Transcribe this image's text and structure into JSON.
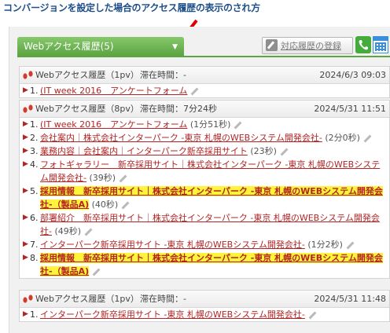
{
  "caption": "コンバージョンを設定した場合のアクセス履歴の表示のされ方",
  "toolbar": {
    "tab_label": "Webアクセス履歴(5)",
    "tab_arrow": "▼",
    "register_label": "対応履歴の登録"
  },
  "visits": [
    {
      "label": "Webアクセス履歴（1pv）",
      "stay": "滞在時間：-",
      "date": "2024/6/3 09:03",
      "pages": [
        {
          "num": "1.",
          "title": "(IT week 2016　アンケートフォーム",
          "suffix": ""
        }
      ]
    },
    {
      "label": "Webアクセス履歴（8pv）",
      "stay": "滞在時間：7分24秒",
      "date": "2024/5/31 11:51",
      "pages": [
        {
          "num": "1.",
          "title": "(IT week 2016　アンケートフォーム",
          "suffix": "(1分51秒)"
        },
        {
          "num": "2.",
          "title": "会社案内｜株式会社インターパーク -東京 札幌のWEBシステム開発会社-",
          "suffix": "(2分0秒)"
        },
        {
          "num": "3.",
          "title": "業務内容｜会社案内｜インターパーク新卒採用サイト",
          "suffix": "(23秒)"
        },
        {
          "num": "4.",
          "title": "フォトギャラリー　新卒採用サイト｜株式会社インターパーク -東京 札幌のWEBシステム開発会社-",
          "suffix": "(39秒)"
        },
        {
          "num": "5.",
          "title": "採用情報　新卒採用サイト｜株式会社インターパーク -東京 札幌のWEBシステム開発会社-（製品A)",
          "suffix": "(40秒)",
          "highlight": true
        },
        {
          "num": "6.",
          "title": "部署紹介　新卒採用サイト｜株式会社インターパーク -東京 札幌のWEBシステム開発会社-",
          "suffix": "(49秒)"
        },
        {
          "num": "7.",
          "title": "インターパーク新卒採用サイト -東京 札幌のWEBシステム開発会社-",
          "suffix": "(1分2秒)"
        },
        {
          "num": "8.",
          "title": "採用情報　新卒採用サイト｜株式会社インターパーク -東京 札幌のWEBシステム開発会社-（製品A)",
          "suffix": "",
          "highlight": true
        }
      ]
    },
    {
      "label": "Webアクセス履歴（1pv）",
      "stay": "滞在時間：-",
      "date": "2024/5/31 11:48",
      "pages": [
        {
          "num": "1.",
          "title": "インターパーク新卒採用サイト -東京 札幌のWEBシステム開発会社-",
          "suffix": ""
        }
      ]
    }
  ]
}
